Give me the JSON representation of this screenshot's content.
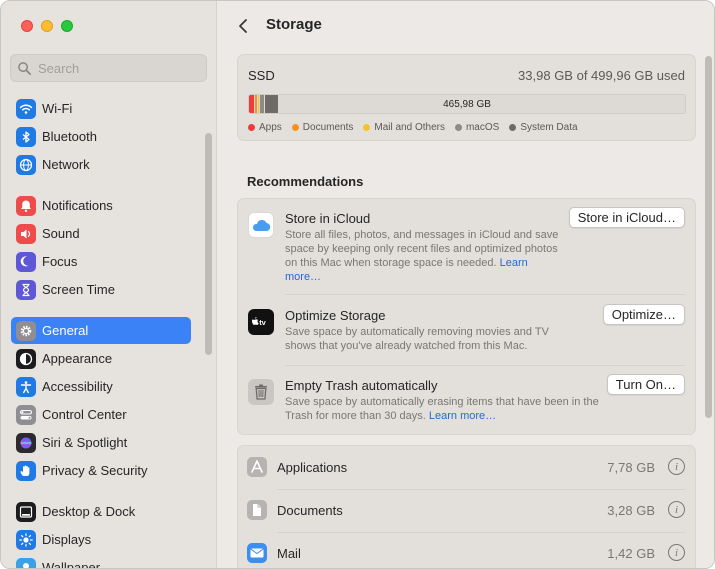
{
  "sidebar": {
    "search_placeholder": "Search",
    "groups": [
      [
        {
          "label": "Wi-Fi",
          "icon": "wifi-icon",
          "color": "#1f7ae6"
        },
        {
          "label": "Bluetooth",
          "icon": "bluetooth-icon",
          "color": "#1f7ae6"
        },
        {
          "label": "Network",
          "icon": "globe-icon",
          "color": "#1f7ae6"
        }
      ],
      [
        {
          "label": "Notifications",
          "icon": "bell-icon",
          "color": "#ef4b4b"
        },
        {
          "label": "Sound",
          "icon": "speaker-icon",
          "color": "#ef4b4b"
        },
        {
          "label": "Focus",
          "icon": "moon-icon",
          "color": "#5f57d8"
        },
        {
          "label": "Screen Time",
          "icon": "hourglass-icon",
          "color": "#5f57d8"
        }
      ],
      [
        {
          "label": "General",
          "icon": "gear-icon",
          "color": "#8e8e93",
          "active": true
        },
        {
          "label": "Appearance",
          "icon": "appearance-icon",
          "color": "#1c1c1e"
        },
        {
          "label": "Accessibility",
          "icon": "accessibility-icon",
          "color": "#1f7ae6"
        },
        {
          "label": "Control Center",
          "icon": "control-center-icon",
          "color": "#8e8e93"
        },
        {
          "label": "Siri & Spotlight",
          "icon": "siri-icon",
          "color": "#2b2b2e"
        },
        {
          "label": "Privacy & Security",
          "icon": "hand-icon",
          "color": "#1f7ae6"
        }
      ],
      [
        {
          "label": "Desktop & Dock",
          "icon": "dock-icon",
          "color": "#1c1c1e"
        },
        {
          "label": "Displays",
          "icon": "sun-icon",
          "color": "#1f7ae6"
        },
        {
          "label": "Wallpaper",
          "icon": "wallpaper-icon",
          "color": "#3aa0e8"
        }
      ]
    ]
  },
  "header": {
    "title": "Storage"
  },
  "ssd": {
    "name": "SSD",
    "used": "33,98 GB of 499,96 GB used",
    "bar_label": "465,98 GB",
    "segments": [
      {
        "name": "Apps",
        "color": "#ee3b3b",
        "fraction": 0.013
      },
      {
        "name": "Documents",
        "color": "#f7921e",
        "fraction": 0.007
      },
      {
        "name": "Mail and Others",
        "color": "#f4c22c",
        "fraction": 0.005
      },
      {
        "name": "macOS",
        "color": "#8e8a86",
        "fraction": 0.012
      },
      {
        "name": "System Data",
        "color": "#6d6a67",
        "fraction": 0.031
      }
    ],
    "legend": [
      "Apps",
      "Documents",
      "Mail and Others",
      "macOS",
      "System Data"
    ]
  },
  "recommendations": {
    "title": "Recommendations",
    "items": [
      {
        "title": "Store in iCloud",
        "desc": "Store all files, photos, and messages in iCloud and save space by keeping only recent files and optimized photos on this Mac when storage space is needed.",
        "link": "Learn more…",
        "button": "Store in iCloud…",
        "icon": "icloud-icon"
      },
      {
        "title": "Optimize Storage",
        "desc": "Save space by automatically removing movies and TV shows that you've already watched from this Mac.",
        "link": "",
        "button": "Optimize…",
        "icon": "appletv-icon",
        "icon_text": "tv"
      },
      {
        "title": "Empty Trash automatically",
        "desc": "Save space by automatically erasing items that have been in the Trash for more than 30 days.",
        "link": "Learn more…",
        "button": "Turn On…",
        "icon": "trash-icon"
      }
    ]
  },
  "categories": [
    {
      "name": "Applications",
      "size": "7,78 GB",
      "icon": "applications-icon"
    },
    {
      "name": "Documents",
      "size": "3,28 GB",
      "icon": "document-icon"
    },
    {
      "name": "Mail",
      "size": "1,42 GB",
      "icon": "mail-icon"
    }
  ],
  "info_glyph": "i"
}
